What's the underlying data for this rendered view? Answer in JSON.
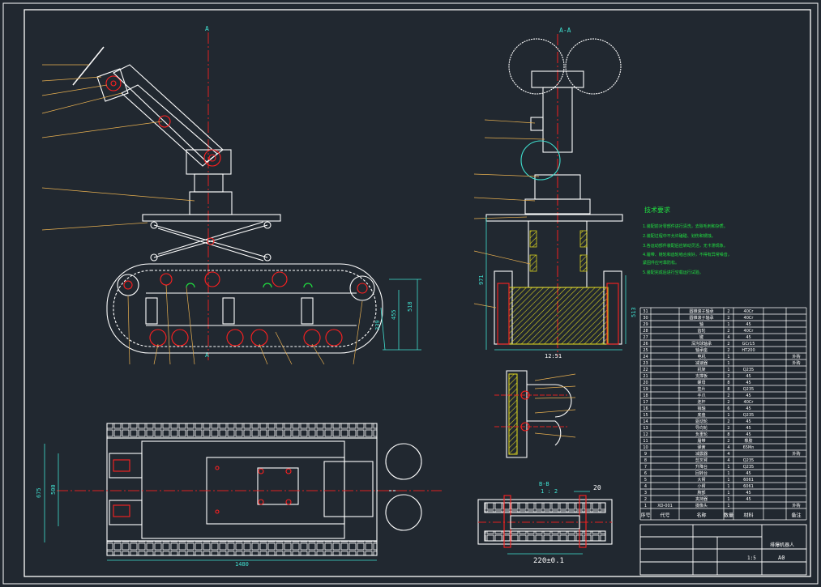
{
  "section_labels": {
    "a_top": "A",
    "a_bottom": "A",
    "aa": "A-A",
    "bb": "B-B",
    "bb_scale": "1 : 2"
  },
  "tech_req": {
    "title": "技术要求",
    "lines": [
      "1.装配前对零部件进行清洗，去除毛刺和杂质。",
      "2.装配过程中不允许磕碰、划伤和锈蚀。",
      "3.各运动部件装配后应转动灵活，无卡滞现象。",
      "4.履带、链轮和齿轮啮合良好，不得有异常噪音，",
      "   紧固件应可靠防松。",
      "5.装配完成后进行空载运行试验。"
    ]
  },
  "dims": {
    "d_height": "518",
    "d_455": "455",
    "d_339": "339",
    "d_width": "1480",
    "d_675": "675",
    "d_500": "500",
    "d_aa_h": "971",
    "d_aa_w": "12:51",
    "d_aa_r": "513",
    "d_bb_w": "220±0.1",
    "d_bb_t": "20"
  },
  "title_block": {
    "name": "排爆机器人",
    "scale": "1:5",
    "sheet": "A0",
    "col_headers": [
      "序号",
      "代号",
      "名称",
      "数量",
      "材料",
      "备注"
    ]
  },
  "bom_rows": [
    [
      "31",
      "",
      "圆锥滚子轴承",
      "2",
      "40Cr",
      ""
    ],
    [
      "30",
      "",
      "圆锥滚子轴承",
      "2",
      "40Cr",
      ""
    ],
    [
      "29",
      "",
      "轴",
      "1",
      "45",
      ""
    ],
    [
      "28",
      "",
      "齿轮",
      "2",
      "40Cr",
      ""
    ],
    [
      "27",
      "",
      "键",
      "4",
      "45",
      ""
    ],
    [
      "26",
      "",
      "深沟球轴承",
      "2",
      "GCr15",
      ""
    ],
    [
      "25",
      "",
      "轴承座",
      "2",
      "HT200",
      ""
    ],
    [
      "24",
      "",
      "电机",
      "1",
      "",
      "外购"
    ],
    [
      "23",
      "",
      "减速器",
      "1",
      "",
      "外购"
    ],
    [
      "22",
      "",
      "机架",
      "1",
      "Q235",
      ""
    ],
    [
      "21",
      "",
      "支撑板",
      "2",
      "45",
      ""
    ],
    [
      "20",
      "",
      "螺母",
      "8",
      "45",
      ""
    ],
    [
      "19",
      "",
      "垫片",
      "8",
      "Q235",
      ""
    ],
    [
      "18",
      "",
      "手爪",
      "2",
      "45",
      ""
    ],
    [
      "17",
      "",
      "连杆",
      "2",
      "40Cr",
      ""
    ],
    [
      "16",
      "",
      "销轴",
      "6",
      "45",
      ""
    ],
    [
      "15",
      "",
      "底盘",
      "1",
      "Q235",
      ""
    ],
    [
      "14",
      "",
      "驱动轮",
      "2",
      "45",
      ""
    ],
    [
      "13",
      "",
      "导向轮",
      "2",
      "45",
      ""
    ],
    [
      "12",
      "",
      "负重轮",
      "8",
      "45",
      ""
    ],
    [
      "11",
      "",
      "履带",
      "2",
      "橡胶",
      ""
    ],
    [
      "10",
      "",
      "弹簧",
      "4",
      "65Mn",
      ""
    ],
    [
      "9",
      "",
      "减震器",
      "4",
      "",
      "外购"
    ],
    [
      "8",
      "",
      "剪叉臂",
      "4",
      "Q235",
      ""
    ],
    [
      "7",
      "",
      "升降台",
      "1",
      "Q235",
      ""
    ],
    [
      "6",
      "",
      "回转台",
      "1",
      "45",
      ""
    ],
    [
      "5",
      "",
      "大臂",
      "1",
      "6061",
      ""
    ],
    [
      "4",
      "",
      "小臂",
      "1",
      "6061",
      ""
    ],
    [
      "3",
      "",
      "腕部",
      "1",
      "45",
      ""
    ],
    [
      "2",
      "",
      "夹持器",
      "1",
      "45",
      ""
    ],
    [
      "1",
      "XD-001",
      "摄像头",
      "1",
      "",
      "外购"
    ]
  ],
  "colors": {
    "bg": "#212830",
    "line": "#ffffff",
    "centerline": "#e02020",
    "dim": "#40e0d0",
    "leader": "#e8b050",
    "note": "#20e040",
    "hatch": "#d8d020",
    "part_red": "#ff2020",
    "part_green": "#20e040"
  }
}
